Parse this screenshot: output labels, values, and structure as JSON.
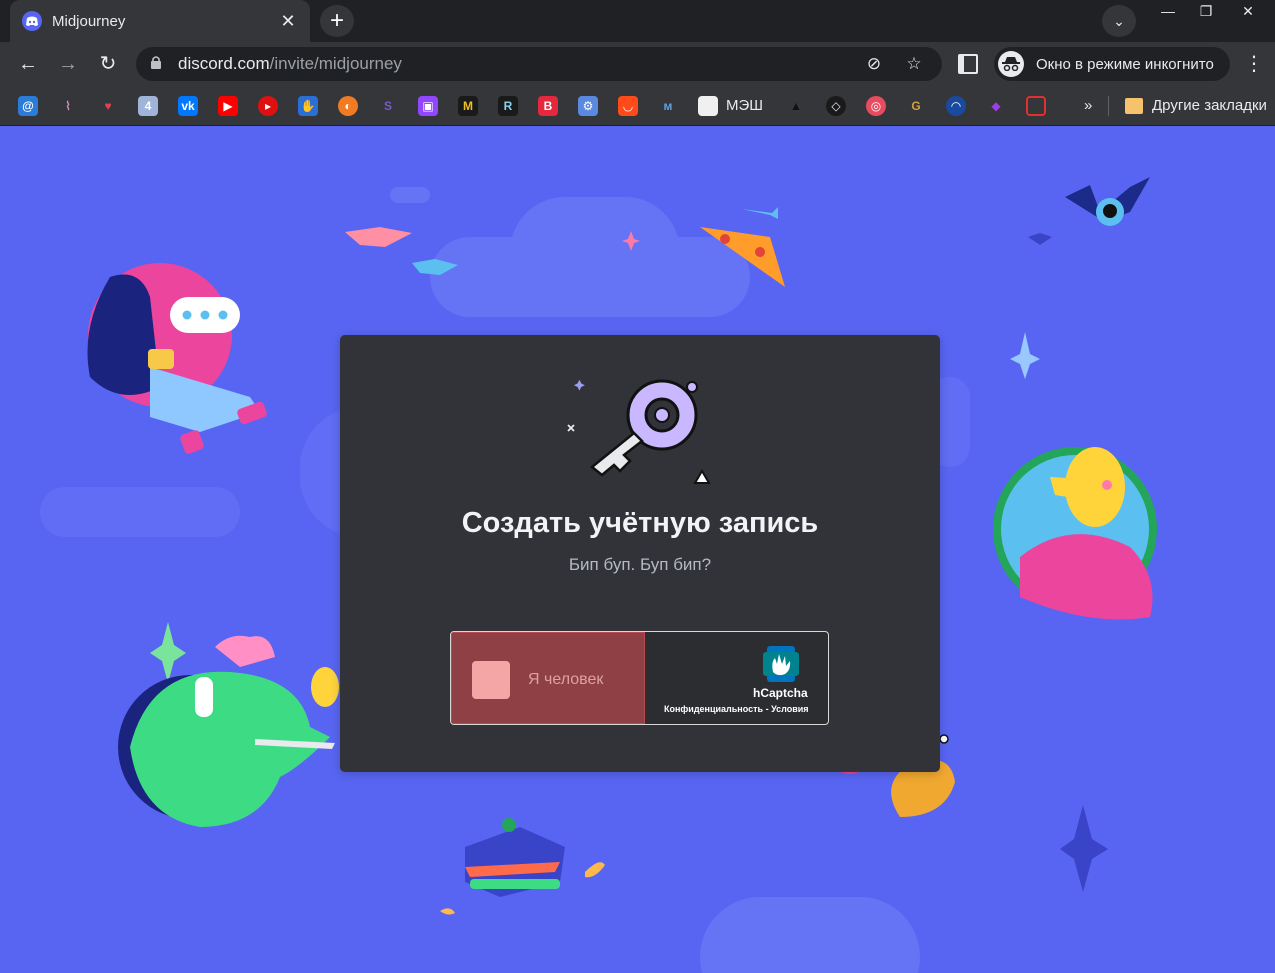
{
  "browser": {
    "tab_title": "Midjourney",
    "tab_close": "✕",
    "new_tab": "+",
    "tab_search": "⌄",
    "window_controls": {
      "minimize": "—",
      "maximize": "❐",
      "close": "✕"
    },
    "nav": {
      "back": "←",
      "forward": "→",
      "reload": "↻"
    },
    "url_host": "discord.com",
    "url_path": "/invite/midjourney",
    "incognito_label": "Окно в режиме инкогнито",
    "menu": "⋮",
    "omni_icons": {
      "eye_off": "⊘",
      "star": "☆"
    },
    "bookmarks": {
      "mesh_label": "МЭШ",
      "more": "»",
      "other_label": "Другие закладки"
    }
  },
  "card": {
    "title": "Создать учётную запись",
    "subtitle": "Бип буп. Буп бип?"
  },
  "captcha": {
    "checkbox_label": "Я человек",
    "brand": "hCaptcha",
    "links": "Конфиденциальность - Условия"
  },
  "colors": {
    "background": "#5865f2",
    "card": "#313338",
    "captcha_error": "#8f4044"
  }
}
